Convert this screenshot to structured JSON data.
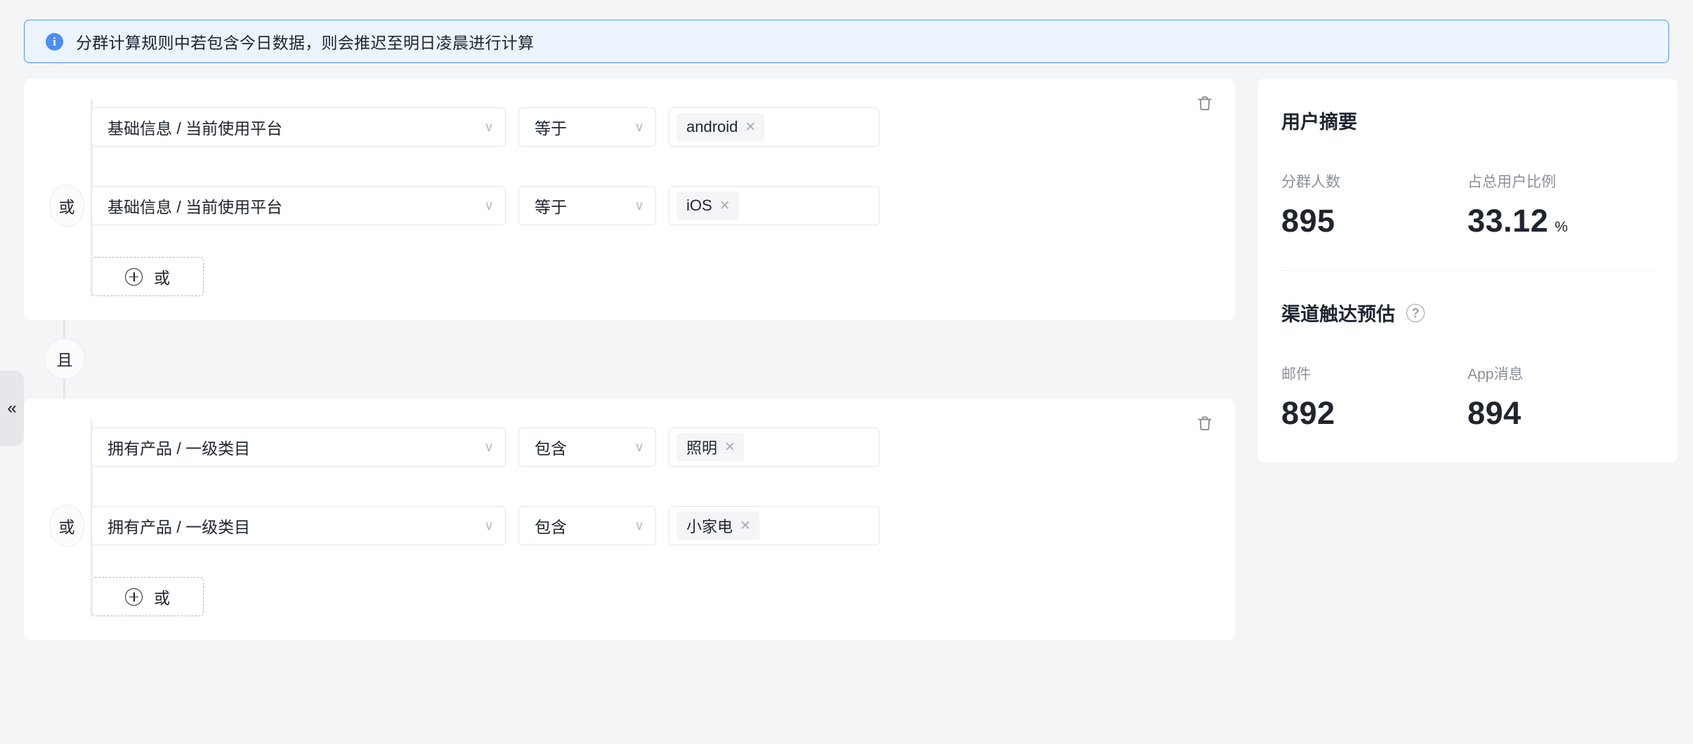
{
  "alert": {
    "icon": "info-circle-icon",
    "text": "分群计算规则中若包含今日数据，则会推迟至明日凌晨进行计算",
    "accent_color": "#4b8ff5",
    "background_color": "#ecf5fe"
  },
  "collapse_handle": {
    "icon": "chevron-double-left-icon",
    "glyph": "«"
  },
  "builder": {
    "group_connector": {
      "label": "且",
      "icon": "and-connector-chip"
    },
    "groups": [
      {
        "delete_icon": "trash-icon",
        "conditions": [
          {
            "connector": null,
            "field": "基础信息 / 当前使用平台",
            "operator": "等于",
            "tags": [
              {
                "label": "android",
                "remove_icon": "close-icon"
              }
            ]
          },
          {
            "connector": "或",
            "field": "基础信息 / 当前使用平台",
            "operator": "等于",
            "tags": [
              {
                "label": "iOS",
                "remove_icon": "close-icon"
              }
            ]
          }
        ],
        "add_button": {
          "label": "或",
          "icon": "plus-circle-icon"
        }
      },
      {
        "delete_icon": "trash-icon",
        "conditions": [
          {
            "connector": null,
            "field": "拥有产品 / 一级类目",
            "operator": "包含",
            "tags": [
              {
                "label": "照明",
                "remove_icon": "close-icon"
              }
            ]
          },
          {
            "connector": "或",
            "field": "拥有产品 / 一级类目",
            "operator": "包含",
            "tags": [
              {
                "label": "小家电",
                "remove_icon": "close-icon"
              }
            ]
          }
        ],
        "add_button": {
          "label": "或",
          "icon": "plus-circle-icon"
        }
      }
    ],
    "caret_glyph": "∨"
  },
  "summary": {
    "blocks": [
      {
        "title": "用户摘要",
        "help_icon": null,
        "metrics": [
          {
            "label": "分群人数",
            "value": "895",
            "unit": ""
          },
          {
            "label": "占总用户比例",
            "value": "33.12",
            "unit": "%"
          }
        ]
      },
      {
        "title": "渠道触达预估",
        "help_icon": "question-circle-icon",
        "help_glyph": "?",
        "metrics": [
          {
            "label": "邮件",
            "value": "892",
            "unit": ""
          },
          {
            "label": "App消息",
            "value": "894",
            "unit": ""
          }
        ]
      }
    ]
  }
}
